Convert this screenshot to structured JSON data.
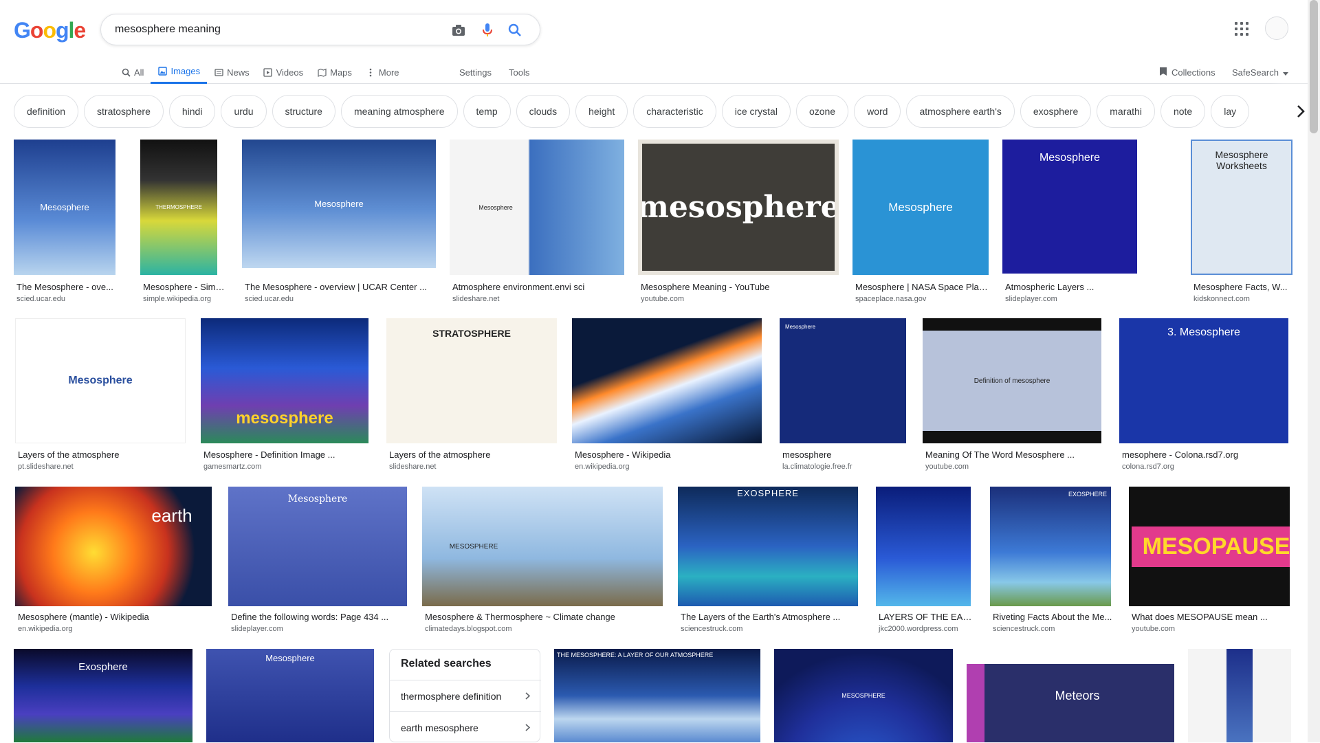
{
  "header": {
    "logo": [
      "G",
      "o",
      "o",
      "g",
      "l",
      "e"
    ],
    "query": "mesosphere meaning"
  },
  "tabs": [
    {
      "label": "All",
      "icon": "search-icon"
    },
    {
      "label": "Images",
      "icon": "image-icon",
      "active": true
    },
    {
      "label": "News",
      "icon": "news-icon"
    },
    {
      "label": "Videos",
      "icon": "video-icon"
    },
    {
      "label": "Maps",
      "icon": "map-icon"
    },
    {
      "label": "More",
      "icon": "more-vert-icon"
    }
  ],
  "tools": {
    "settings": "Settings",
    "tools": "Tools",
    "collections": "Collections",
    "safesearch": "SafeSearch"
  },
  "chips": [
    "definition",
    "stratosphere",
    "hindi",
    "urdu",
    "structure",
    "meaning atmosphere",
    "temp",
    "clouds",
    "height",
    "characteristic",
    "ice crystal",
    "ozone",
    "word",
    "atmosphere earth's",
    "exosphere",
    "marathi",
    "note",
    "lay"
  ],
  "row1": [
    {
      "title": "The Mesosphere - ove...",
      "src": "scied.ucar.edu",
      "label": "Mesosphere"
    },
    {
      "title": "Mesosphere - Simple ...",
      "src": "simple.wikipedia.org",
      "label": "THERMOSPHERE"
    },
    {
      "title": "The Mesosphere - overview | UCAR Center ...",
      "src": "scied.ucar.edu",
      "label": "Mesosphere"
    },
    {
      "title": "Atmosphere environment.envi sci",
      "src": "slideshare.net",
      "label": "Mesosphere"
    },
    {
      "title": "Mesosphere Meaning - YouTube",
      "src": "youtube.com",
      "label": "mesosphere"
    },
    {
      "title": "Mesosphere | NASA Space Plac...",
      "src": "spaceplace.nasa.gov",
      "label": "Mesosphere"
    },
    {
      "title": "Atmospheric Layers ...",
      "src": "slideplayer.com",
      "label": "Mesosphere"
    },
    {
      "title": "Mesosphere Facts, W...",
      "src": "kidskonnect.com",
      "label": "Mesosphere Worksheets"
    }
  ],
  "row2": [
    {
      "title": "Layers of the atmosphere",
      "src": "pt.slideshare.net",
      "label": "Mesosphere"
    },
    {
      "title": "Mesosphere - Definition Image ...",
      "src": "gamesmartz.com",
      "label": "mesosphere"
    },
    {
      "title": "Layers of the atmosphere",
      "src": "slideshare.net",
      "label": "STRATOSPHERE"
    },
    {
      "title": "Mesosphere - Wikipedia",
      "src": "en.wikipedia.org",
      "label": ""
    },
    {
      "title": "mesosphere",
      "src": "la.climatologie.free.fr",
      "label": "Mesosphere"
    },
    {
      "title": "Meaning Of The Word Mesosphere ...",
      "src": "youtube.com",
      "label": "Definition of mesosphere"
    },
    {
      "title": "mesophere - Colona.rsd7.org",
      "src": "colona.rsd7.org",
      "label": "3. Mesosphere"
    }
  ],
  "row3": [
    {
      "title": "Mesosphere (mantle) - Wikipedia",
      "src": "en.wikipedia.org",
      "label": "earth"
    },
    {
      "title": "Define the following words: Page 434 ...",
      "src": "slideplayer.com",
      "label": "Mesosphere"
    },
    {
      "title": "Mesosphere & Thermosphere ~ Climate change",
      "src": "climatedays.blogspot.com",
      "label": "MESOSPHERE"
    },
    {
      "title": "The Layers of the Earth's Atmosphere ...",
      "src": "sciencestruck.com",
      "label": "EXOSPHERE"
    },
    {
      "title": "LAYERS OF THE EAR...",
      "src": "jkc2000.wordpress.com",
      "label": ""
    },
    {
      "title": "Riveting Facts About the Me...",
      "src": "sciencestruck.com",
      "label": "EXOSPHERE"
    },
    {
      "title": "What does MESOPAUSE mean ...",
      "src": "youtube.com",
      "label": "MESOPAUSE"
    }
  ],
  "row4": [
    {
      "label": "Exosphere"
    },
    {
      "label": "Mesosphere"
    },
    {
      "label": "THE MESOSPHERE: A LAYER OF OUR ATMOSPHERE"
    },
    {
      "label": "MESOSPHERE"
    },
    {
      "label": "Meteors"
    },
    {
      "label": ""
    }
  ],
  "related": {
    "title": "Related searches",
    "items": [
      "thermosphere definition",
      "earth mesosphere"
    ]
  },
  "colors": {
    "accent": "#1a73e8"
  }
}
